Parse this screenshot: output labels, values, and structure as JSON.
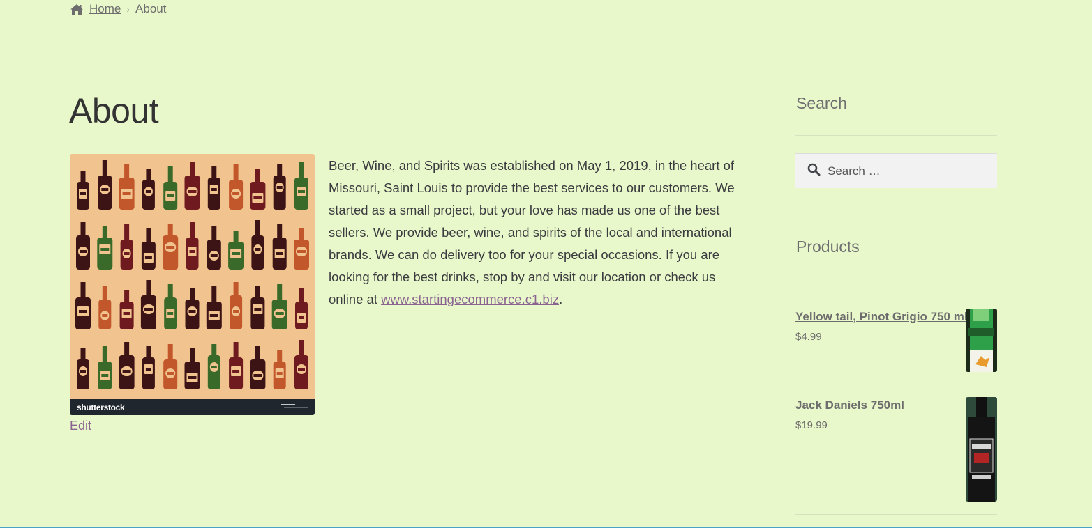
{
  "breadcrumb": {
    "home_label": "Home",
    "current_label": "About"
  },
  "page": {
    "title": "About",
    "body_text": "Beer, Wine, and Spirits was established on May 1, 2019, in the heart of Missouri, Saint Louis to provide the best services to our customers. We started as a small project, but your love has made us one of the best sellers. We provide beer, wine, and spirits of the local and international brands. We can do delivery too for your special occasions. If you are looking for the best drinks, stop by and visit our location or check us online at ",
    "link_text": "www.startingecommerce.c1.biz",
    "after_link": ".",
    "edit_label": "Edit",
    "image_watermark": "shutterstock"
  },
  "sidebar": {
    "search": {
      "title": "Search",
      "placeholder": "Search …"
    },
    "products": {
      "title": "Products",
      "items": [
        {
          "name": "Yellow tail, Pinot Grigio 750 ml",
          "price": "$4.99"
        },
        {
          "name": "Jack Daniels 750ml",
          "price": "$19.99"
        }
      ]
    }
  },
  "colors": {
    "background": "#e9f8cb",
    "link": "#8a6490",
    "accent_line": "#4aa3c7"
  }
}
